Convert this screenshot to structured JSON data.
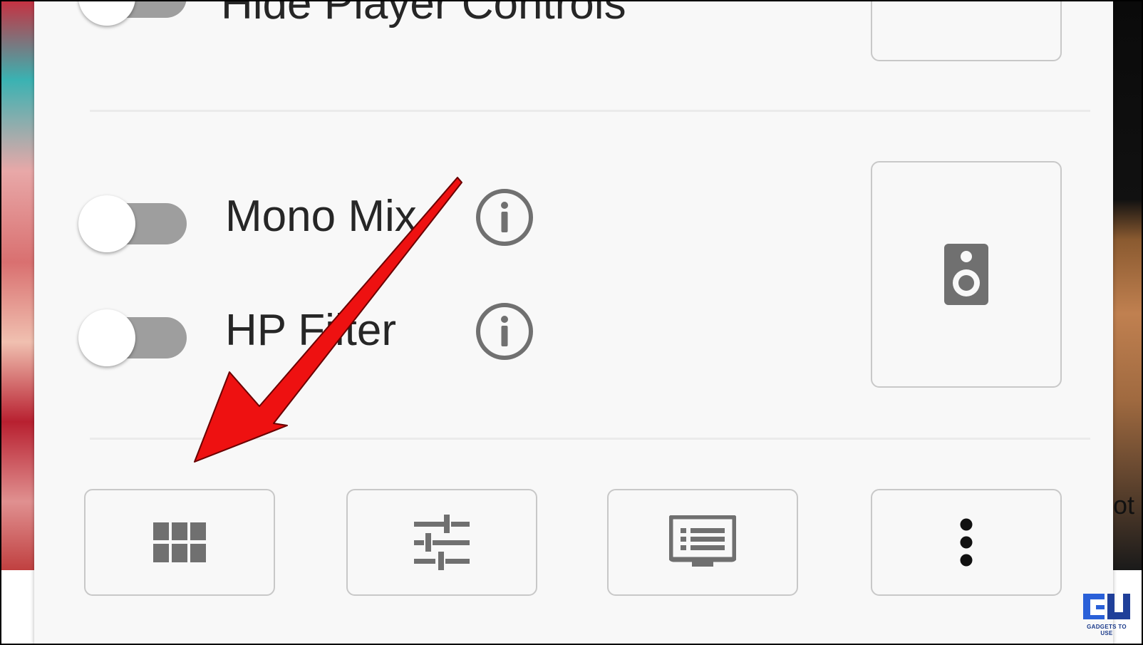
{
  "settings": {
    "hide_player_controls": {
      "label": "Hide Player Controls",
      "enabled": false
    },
    "mono_mix": {
      "label": "Mono Mix",
      "enabled": false
    },
    "hp_filter": {
      "label": "HP Filter",
      "enabled": false
    }
  },
  "side_buttons": {
    "top": {
      "icon": "blank"
    },
    "audio_output": {
      "icon": "speaker-icon"
    }
  },
  "bottom_bar": [
    {
      "icon": "grid-icon"
    },
    {
      "icon": "sliders-icon"
    },
    {
      "icon": "display-list-icon"
    },
    {
      "icon": "more-vert-icon"
    }
  ],
  "background": {
    "right_text": "ot"
  },
  "watermark": {
    "brand": "GU",
    "tagline": "GADGETS TO USE"
  },
  "colors": {
    "panel_bg": "#f8f8f8",
    "icon_gray": "#707070",
    "toggle_track": "#9e9e9e",
    "arrow_red": "#ee1111"
  }
}
